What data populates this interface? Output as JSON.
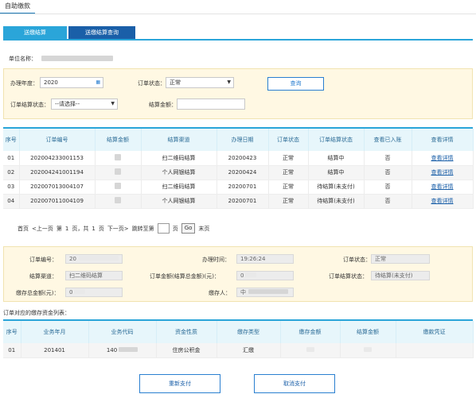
{
  "header": {
    "tab": "自助缴款"
  },
  "subtabs": [
    "送缴结算",
    "送缴结算查询"
  ],
  "unit": {
    "label": "单位名称："
  },
  "filters": {
    "year_label": "办理年度：",
    "year_value": "2020",
    "status_label": "订单状态：",
    "status_value": "正常",
    "query_button": "查询",
    "settle_status_label": "订单结算状态：",
    "settle_status_value": "--请选择--",
    "amount_label": "结算金额："
  },
  "orders": {
    "headers": [
      "序号",
      "订单编号",
      "结算金额",
      "结算渠道",
      "办理日期",
      "订单状态",
      "订单结算状态",
      "查看已入账",
      "查看详情"
    ],
    "rows": [
      [
        "01",
        "202004233001153",
        "",
        "扫二维码结算",
        "20200423",
        "正常",
        "结算中",
        "否",
        "查看详情"
      ],
      [
        "02",
        "202004241001194",
        "",
        "个人网银结算",
        "20200424",
        "正常",
        "结算中",
        "否",
        "查看详情"
      ],
      [
        "03",
        "202007013004107",
        "",
        "扫二维码结算",
        "20200701",
        "正常",
        "待结算(未支付)",
        "否",
        "查看详情"
      ],
      [
        "04",
        "202007011004109",
        "",
        "个人网银结算",
        "20200701",
        "正常",
        "待结算(未支付)",
        "否",
        "查看详情"
      ]
    ]
  },
  "pager": {
    "first": "首页",
    "prev": "<上一页",
    "page_prefix": "第",
    "page_current": "1",
    "page_mid": "页，共",
    "page_total": "1",
    "page_suffix": "页",
    "next": "下一页>",
    "jump_label": "跳转至第",
    "jump_unit": "页",
    "go": "Go",
    "last": "末页"
  },
  "detail": {
    "order_no_label": "订单编号：",
    "order_no_value": "20",
    "time_label": "办理时间：",
    "time_value": "19:26:24",
    "order_status_label": "订单状态：",
    "order_status_value": "正常",
    "channel_label": "结算渠道：",
    "channel_value": "扫二维码结算",
    "amount_label": "订单金额(结算总金额)(元)：",
    "amount_value": "0",
    "settle_status_label": "订单结算状态：",
    "settle_status_value": "待结算(未支付)",
    "deposit_label": "缴存总金额(元)：",
    "deposit_value": "0",
    "payer_label": "缴存人：",
    "payer_value": "中"
  },
  "funds": {
    "title": "订单对应的缴存资金列表：",
    "headers": [
      "序号",
      "业务年月",
      "业务代码",
      "资金性质",
      "缴存类型",
      "缴存金额",
      "结算金额",
      "缴款凭证"
    ],
    "rows": [
      [
        "01",
        "201401",
        "140",
        "住房公积金",
        "汇缴",
        "",
        "",
        ""
      ]
    ]
  },
  "actions": {
    "repay": "重新支付",
    "cancel": "取消支付"
  }
}
